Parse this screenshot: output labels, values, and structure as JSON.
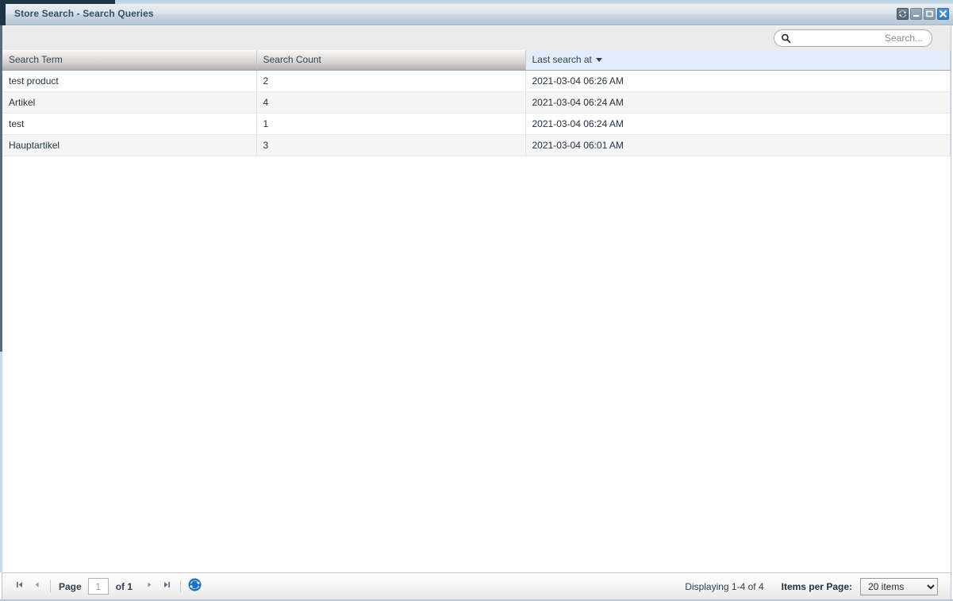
{
  "window": {
    "title": "Store Search - Search Queries",
    "controls": [
      {
        "name": "restore-tool-button",
        "icon": "restore-icon",
        "label": ""
      },
      {
        "name": "minimize-button",
        "icon": "minimize-icon",
        "label": ""
      },
      {
        "name": "maximize-button",
        "icon": "maximize-icon",
        "label": ""
      },
      {
        "name": "close-button",
        "icon": "close-icon",
        "label": ""
      }
    ]
  },
  "toolbar": {
    "search": {
      "icon": "search-icon",
      "value": "",
      "placeholder": "Search..."
    }
  },
  "grid": {
    "columns": [
      {
        "key": "term",
        "label": "Search Term",
        "sorted": false,
        "sort_dir": ""
      },
      {
        "key": "count",
        "label": "Search Count",
        "sorted": false,
        "sort_dir": ""
      },
      {
        "key": "last",
        "label": "Last search at",
        "sorted": true,
        "sort_dir": "desc"
      }
    ],
    "rows": [
      {
        "term": "test product",
        "count": "2",
        "last": "2021-03-04 06:26 AM"
      },
      {
        "term": "Artikel",
        "count": "4",
        "last": "2021-03-04 06:24 AM"
      },
      {
        "term": "test",
        "count": "1",
        "last": "2021-03-04 06:24 AM"
      },
      {
        "term": "Hauptartikel",
        "count": "3",
        "last": "2021-03-04 06:01 AM"
      }
    ]
  },
  "footer": {
    "first_label": "",
    "prev_label": "",
    "page_label": "Page",
    "page_value": "1",
    "of_label": "of 1",
    "next_label": "",
    "last_label": "",
    "refresh_label": "",
    "displaying": "Displaying 1-4 of 4",
    "items_per_page_label": "Items per Page:",
    "items_per_page_value": "20 items",
    "items_per_page_options": [
      "20 items"
    ]
  },
  "colors": {
    "accent_blue": "#2f7ec4",
    "sorted_header_bg": "#e3edf9",
    "titlebar_dark": "#1f3347",
    "row_alt_bg": "#f5f5f5"
  }
}
